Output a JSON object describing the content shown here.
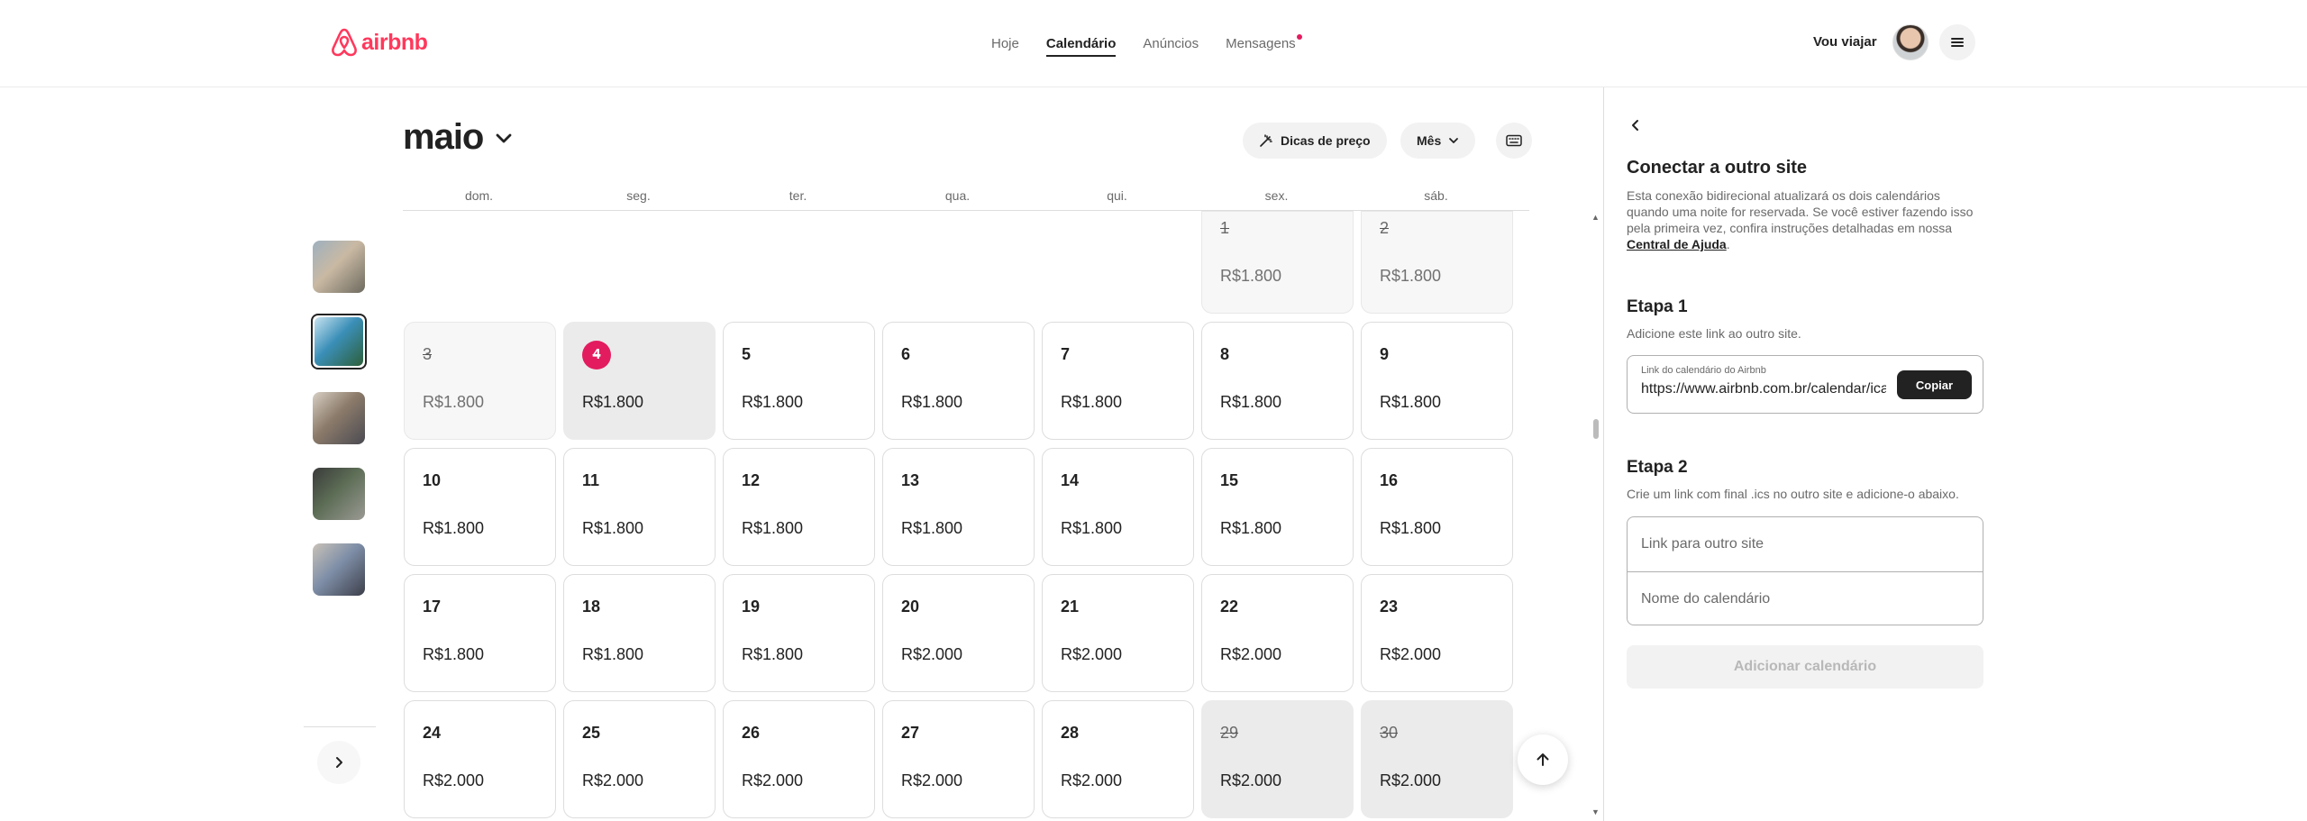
{
  "header": {
    "logo_text": "airbnb",
    "nav": [
      {
        "label": "Hoje"
      },
      {
        "label": "Calendário"
      },
      {
        "label": "Anúncios"
      },
      {
        "label": "Mensagens"
      }
    ],
    "host_switch": "Vou viajar",
    "brand_color": "#ff385c"
  },
  "calendar": {
    "month": "maio",
    "price_tips_label": "Dicas de preço",
    "view_label": "Mês",
    "weekdays": [
      "dom.",
      "seg.",
      "ter.",
      "qua.",
      "qui.",
      "sex.",
      "sáb."
    ],
    "days": [
      {
        "day": "1",
        "price": "R$1.800",
        "state": "past"
      },
      {
        "day": "2",
        "price": "R$1.800",
        "state": "past"
      },
      {
        "day": "3",
        "price": "R$1.800",
        "state": "past"
      },
      {
        "day": "4",
        "price": "R$1.800",
        "state": "today"
      },
      {
        "day": "5",
        "price": "R$1.800",
        "state": "open"
      },
      {
        "day": "6",
        "price": "R$1.800",
        "state": "open"
      },
      {
        "day": "7",
        "price": "R$1.800",
        "state": "open"
      },
      {
        "day": "8",
        "price": "R$1.800",
        "state": "open"
      },
      {
        "day": "9",
        "price": "R$1.800",
        "state": "open"
      },
      {
        "day": "10",
        "price": "R$1.800",
        "state": "open"
      },
      {
        "day": "11",
        "price": "R$1.800",
        "state": "open"
      },
      {
        "day": "12",
        "price": "R$1.800",
        "state": "open"
      },
      {
        "day": "13",
        "price": "R$1.800",
        "state": "open"
      },
      {
        "day": "14",
        "price": "R$1.800",
        "state": "open"
      },
      {
        "day": "15",
        "price": "R$1.800",
        "state": "open"
      },
      {
        "day": "16",
        "price": "R$1.800",
        "state": "open"
      },
      {
        "day": "17",
        "price": "R$1.800",
        "state": "open"
      },
      {
        "day": "18",
        "price": "R$1.800",
        "state": "open"
      },
      {
        "day": "19",
        "price": "R$1.800",
        "state": "open"
      },
      {
        "day": "20",
        "price": "R$2.000",
        "state": "open"
      },
      {
        "day": "21",
        "price": "R$2.000",
        "state": "open"
      },
      {
        "day": "22",
        "price": "R$2.000",
        "state": "open"
      },
      {
        "day": "23",
        "price": "R$2.000",
        "state": "open"
      },
      {
        "day": "24",
        "price": "R$2.000",
        "state": "open"
      },
      {
        "day": "25",
        "price": "R$2.000",
        "state": "open"
      },
      {
        "day": "26",
        "price": "R$2.000",
        "state": "open"
      },
      {
        "day": "27",
        "price": "R$2.000",
        "state": "open"
      },
      {
        "day": "28",
        "price": "R$2.000",
        "state": "open"
      },
      {
        "day": "29",
        "price": "R$2.000",
        "state": "blocked"
      },
      {
        "day": "30",
        "price": "R$2.000",
        "state": "blocked"
      }
    ]
  },
  "listings": [
    {
      "colors": [
        "#c9b9a3",
        "#6d6a5f",
        "#9eb0bf"
      ]
    },
    {
      "colors": [
        "#3b8fb8",
        "#2d5f3a",
        "#c7e3f0"
      ]
    },
    {
      "colors": [
        "#8c7b6a",
        "#4a4a52",
        "#d7cfc4"
      ]
    },
    {
      "colors": [
        "#5c6d55",
        "#9b9a94",
        "#3a3a3a"
      ]
    },
    {
      "colors": [
        "#7f8fa8",
        "#3d3f4a",
        "#c9c2b8"
      ]
    }
  ],
  "panel": {
    "title": "Conectar a outro site",
    "description": "Esta conexão bidirecional atualizará os dois calendários quando uma noite for reservada. Se você estiver fazendo isso pela primeira vez, confira instruções detalhadas em nossa",
    "help_link": "Central de Ajuda",
    "step1_title": "Etapa 1",
    "step1_sub": "Adicione este link ao outro site.",
    "link_label": "Link do calendário do Airbnb",
    "link_value": "https://www.airbnb.com.br/calendar/ical/",
    "copy_label": "Copiar",
    "step2_title": "Etapa 2",
    "step2_sub": "Crie um link com final .ics no outro site e adicione-o abaixo.",
    "other_link_placeholder": "Link para outro site",
    "calendar_name_placeholder": "Nome do calendário",
    "add_label": "Adicionar calendário"
  }
}
